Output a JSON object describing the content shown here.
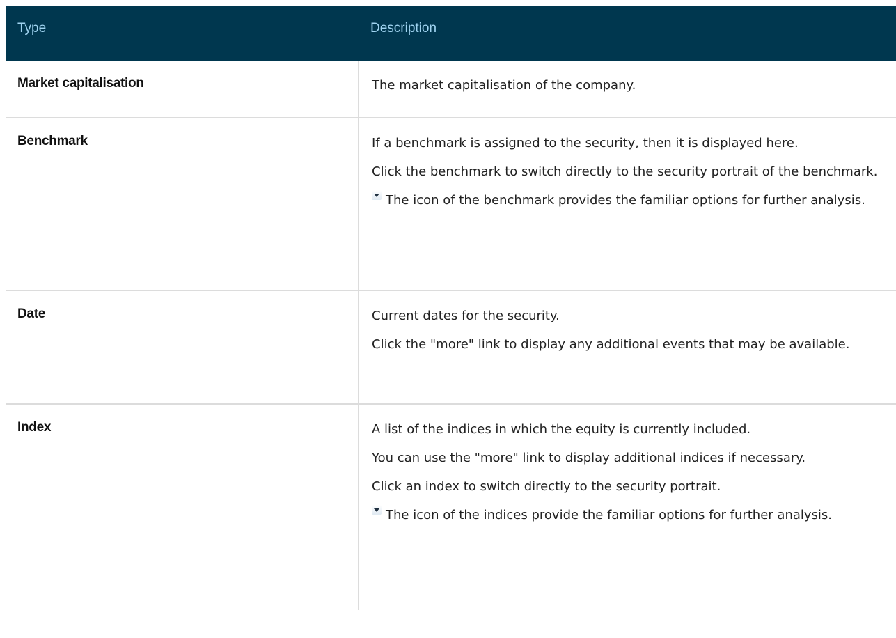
{
  "table": {
    "headers": {
      "type": "Type",
      "description": "Description"
    },
    "rows": [
      {
        "type": "Market capitalisation",
        "paragraphs": [
          "The market capitalisation of the company."
        ]
      },
      {
        "type": "Benchmark",
        "paragraphs": [
          "If a benchmark is assigned to the security, then it is displayed here.",
          "Click the benchmark to switch directly to the security portrait of the benchmark.",
          "The icon of the benchmark provides the familiar options for further analysis."
        ],
        "icon": "dropdown-arrow-icon"
      },
      {
        "type": "Date",
        "paragraphs": [
          "Current dates for the security.",
          "Click the \"more\" link to display any additional events that may be available."
        ]
      },
      {
        "type": "Index",
        "paragraphs": [
          "A list of the indices in which the equity is currently included.",
          "You can use the \"more\" link to display additional indices if necessary.",
          "Click an index to switch directly to the security portrait.",
          "The icon of the indices provide the familiar options for further analysis."
        ],
        "icon": "dropdown-arrow-icon"
      }
    ]
  },
  "colors": {
    "header_bg": "#00374f",
    "header_text": "#9fd3f0",
    "border": "#dcdcdc"
  }
}
